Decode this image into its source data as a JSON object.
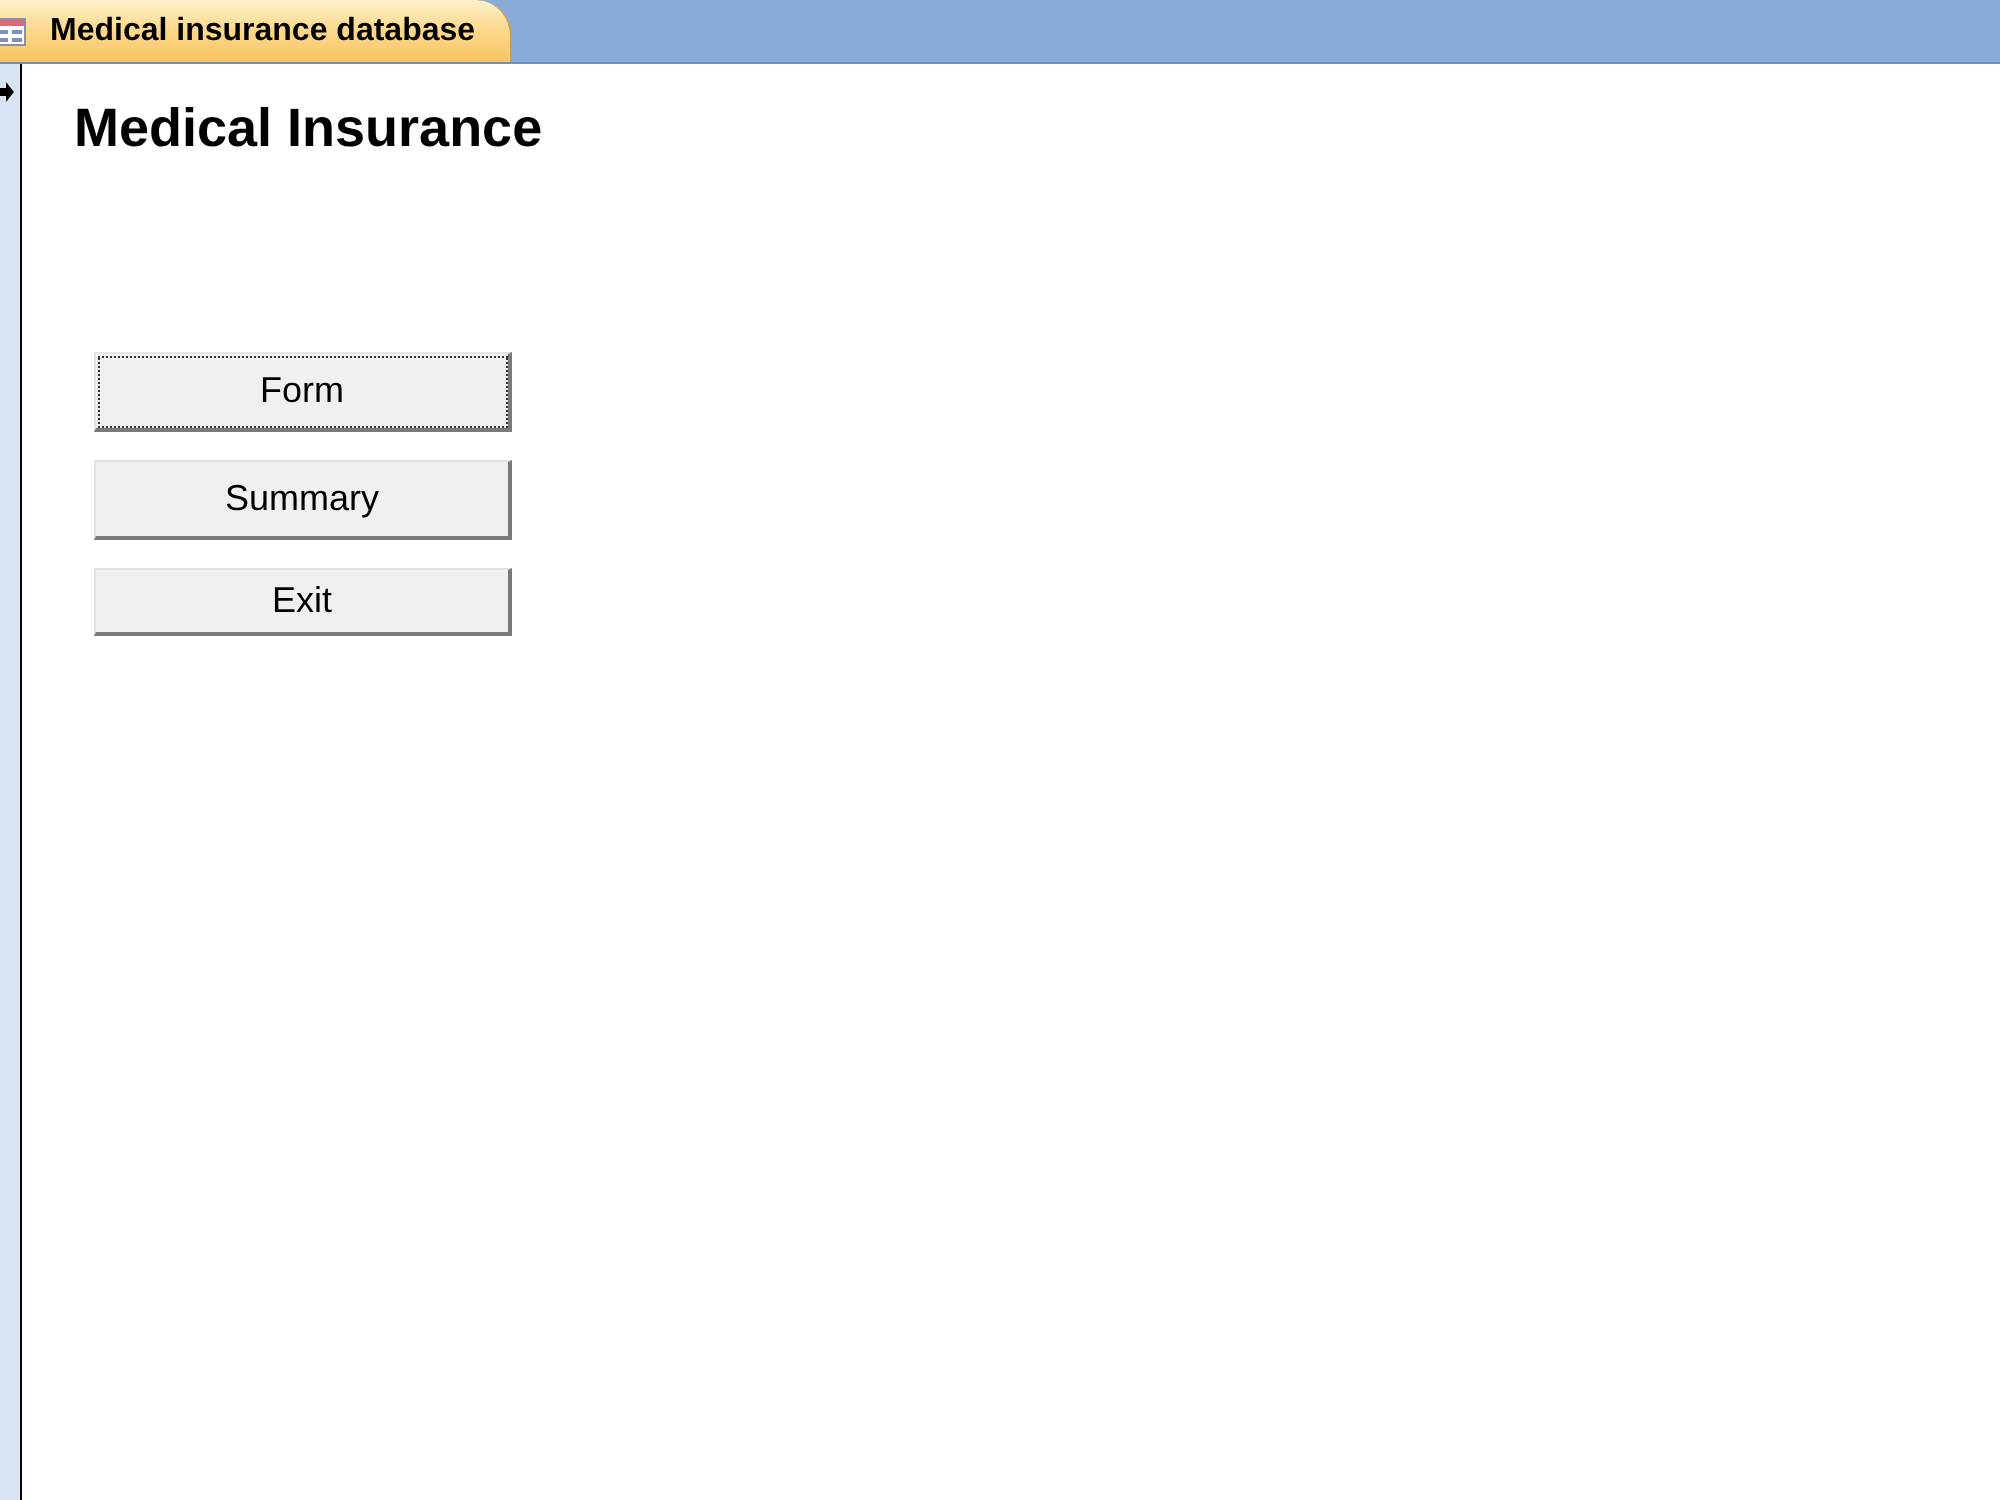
{
  "document_tab": {
    "title": "Medical insurance database",
    "selected": true
  },
  "record_selector": {
    "current": true
  },
  "form": {
    "heading": "Medical Insurance",
    "buttons": [
      {
        "label": "Form",
        "focused": true
      },
      {
        "label": "Summary",
        "focused": false
      },
      {
        "label": "Exit",
        "focused": false
      }
    ]
  }
}
